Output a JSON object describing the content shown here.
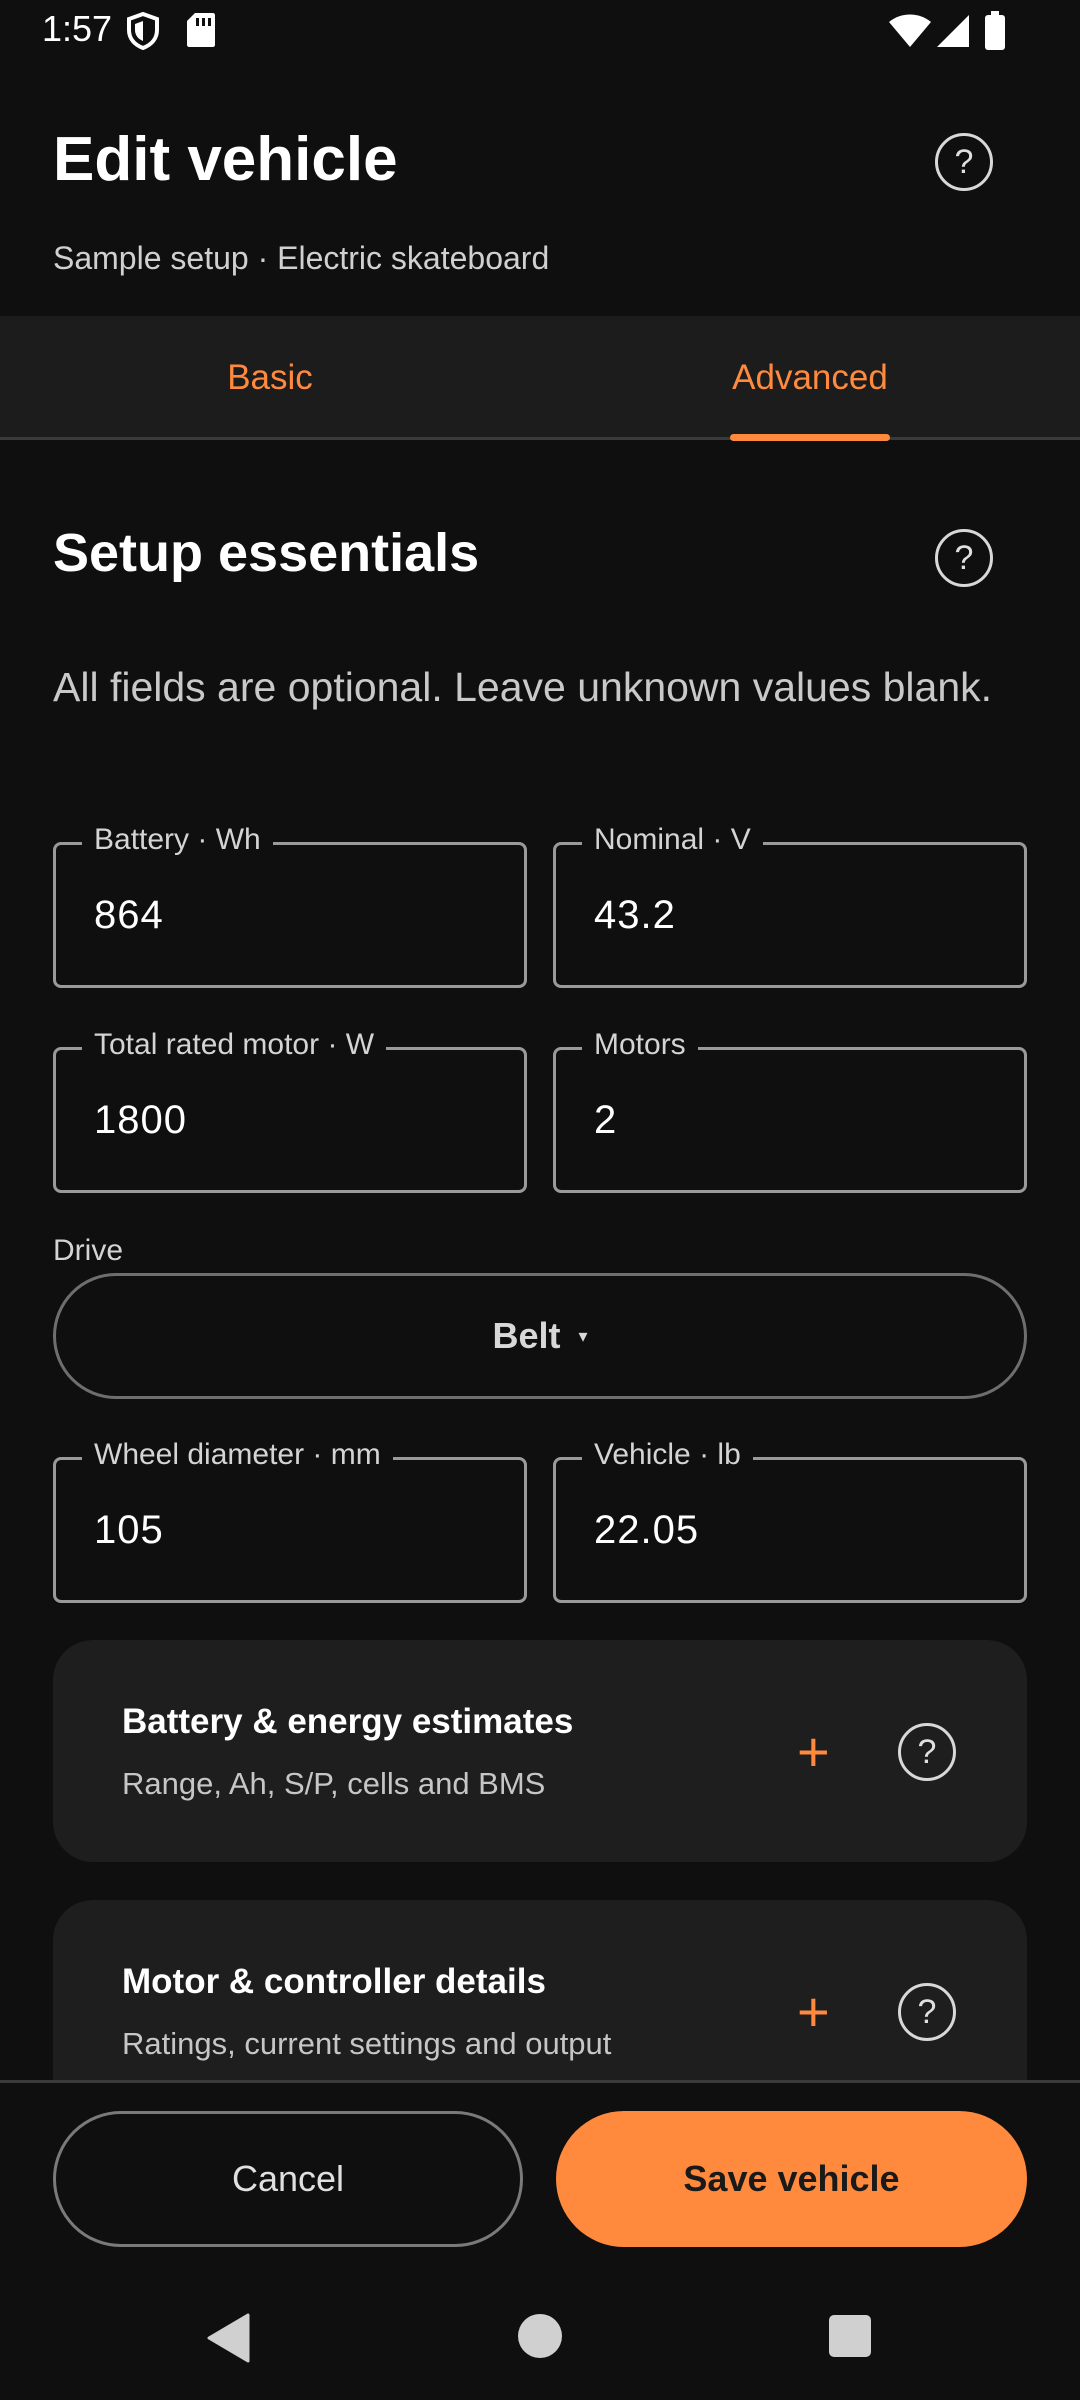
{
  "status_bar": {
    "time": "1:57",
    "icons": [
      "shield-icon",
      "sd-card-icon",
      "wifi-icon",
      "signal-icon",
      "battery-icon"
    ]
  },
  "header": {
    "title": "Edit vehicle",
    "subtitle": "Sample setup · Electric skateboard",
    "help_icon": "?"
  },
  "tabs": [
    {
      "label": "Basic",
      "selected": false
    },
    {
      "label": "Advanced",
      "selected": true
    }
  ],
  "section": {
    "title": "Setup essentials",
    "help_icon": "?",
    "description": "All fields are optional. Leave unknown values blank."
  },
  "fields": {
    "battery": {
      "label": "Battery · Wh",
      "value": "864"
    },
    "nominal": {
      "label": "Nominal · V",
      "value": "43.2"
    },
    "motor_power": {
      "label": "Total rated motor · W",
      "value": "1800"
    },
    "motors": {
      "label": "Motors",
      "value": "2"
    },
    "wheel": {
      "label": "Wheel diameter · mm",
      "value": "105"
    },
    "vehicle_weight": {
      "label": "Vehicle · lb",
      "value": "22.05"
    }
  },
  "drive": {
    "label": "Drive",
    "value": "Belt",
    "caret": "▾"
  },
  "cards": [
    {
      "title": "Battery & energy estimates",
      "subtitle": "Range, Ah, S/P, cells and BMS",
      "plus": "+",
      "help": "?"
    },
    {
      "title": "Motor & controller details",
      "subtitle": "Ratings, current settings and output",
      "plus": "+",
      "help": "?"
    }
  ],
  "actions": {
    "cancel": "Cancel",
    "save": "Save vehicle"
  },
  "colors": {
    "accent": "#ff8a3d",
    "background": "#0f0f10",
    "surface": "#1e1e1f"
  }
}
